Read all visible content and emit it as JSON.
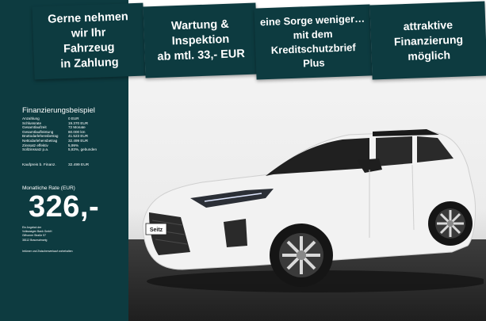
{
  "banners": [
    "Gerne nehmen\nwir Ihr\nFahrzeug\nin Zahlung",
    "Wartung &\nInspektion\nab mtl. 33,- EUR",
    "eine Sorge weniger…\nmit dem\nKreditschutzbrief\nPlus",
    "attraktive\nFinanzierung\nmöglich"
  ],
  "financing": {
    "title": "Finanzierungsbeispiel",
    "rows": [
      {
        "label": "Anzahlung",
        "value": "0 EUR"
      },
      {
        "label": "Schlussrate",
        "value": "19.370 EUR"
      },
      {
        "label": "Gesamtlaufzeit",
        "value": "72 Monate"
      },
      {
        "label": "Gesamtlaufleistung",
        "value": "60.000 km"
      },
      {
        "label": "Bruttodarlehensbetrag",
        "value": "41.523 EUR"
      },
      {
        "label": "Nettodarlehensbetrag",
        "value": "32.499 EUR"
      },
      {
        "label": "Zinssatz effektiv",
        "value": "5,99%"
      },
      {
        "label": "Sollzinssatz p.a.",
        "value": "5,83%, gebunden"
      }
    ],
    "purchase_label": "Kaufpreis b. Finanz.",
    "purchase_value": "32.499 EUR"
  },
  "rate": {
    "label": "Monatliche Rate (EUR)",
    "value": "326,-"
  },
  "bank_info": [
    "Ein Angebot der",
    "Volkswagen Bank GmbH",
    "Gifhorner Straße 57",
    "38112 Braunschweig"
  ],
  "note": "Irrtümer und Zwischenverkauf vorbehalten",
  "plate_text": "Seitz",
  "colors": {
    "panel": "#0d3b40",
    "text": "#ffffff",
    "car": "#f2f2f2"
  }
}
